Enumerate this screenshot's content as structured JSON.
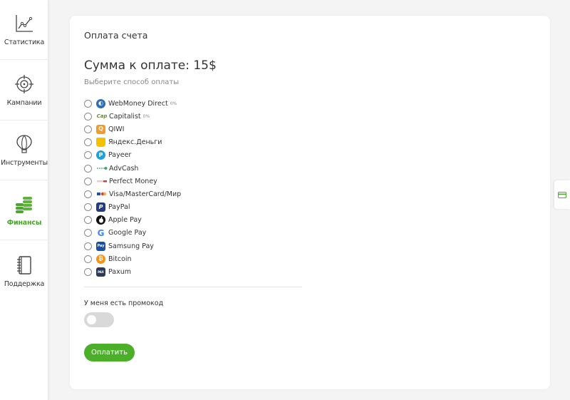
{
  "sidebar": {
    "items": [
      {
        "label": "Статистика",
        "icon": "chart-icon"
      },
      {
        "label": "Кампании",
        "icon": "target-icon"
      },
      {
        "label": "Инструменты",
        "icon": "balloon-icon"
      },
      {
        "label": "Финансы",
        "icon": "coins-icon",
        "active": true
      },
      {
        "label": "Поддержка",
        "icon": "notebook-icon"
      }
    ]
  },
  "card": {
    "title": "Оплата счета",
    "amount": "Сумма к оплате: 15$",
    "hint": "Выберите способ оплаты",
    "methods": [
      {
        "name": "WebMoney Direct",
        "fee": "0%",
        "icon": "webmoney-icon",
        "color": "#2d6fb3"
      },
      {
        "name": "Capitalist",
        "fee": "0%",
        "icon": "capitalist-icon",
        "color": "#6a8a3a"
      },
      {
        "name": "QIWI",
        "fee": "",
        "icon": "qiwi-icon",
        "color": "#f29a2e"
      },
      {
        "name": "Яндекс.Деньги",
        "fee": "",
        "icon": "yandex-money-icon",
        "color": "#f2c200"
      },
      {
        "name": "Payeer",
        "fee": "",
        "icon": "payeer-icon",
        "color": "#1ea0d8"
      },
      {
        "name": "AdvCash",
        "fee": "",
        "icon": "advcash-icon",
        "color": "#3aa776"
      },
      {
        "name": "Perfect Money",
        "fee": "",
        "icon": "perfect-money-icon",
        "color": "#d23a3a"
      },
      {
        "name": "Visa/MasterCard/Мир",
        "fee": "",
        "icon": "card-icon",
        "color": "#e87a2a"
      },
      {
        "name": "PayPal",
        "fee": "",
        "icon": "paypal-icon",
        "color": "#253b80"
      },
      {
        "name": "Apple Pay",
        "fee": "",
        "icon": "apple-icon",
        "color": "#111111"
      },
      {
        "name": "Google Pay",
        "fee": "",
        "icon": "google-icon",
        "color": "#4285f4"
      },
      {
        "name": "Samsung Pay",
        "fee": "",
        "icon": "samsung-pay-icon",
        "color": "#1b4fa0"
      },
      {
        "name": "Bitcoin",
        "fee": "",
        "icon": "bitcoin-icon",
        "color": "#f7931a"
      },
      {
        "name": "Paxum",
        "fee": "",
        "icon": "paxum-icon",
        "color": "#2a3a55"
      }
    ],
    "promo_label": "У меня есть промокод",
    "promo_enabled": false,
    "pay_button": "Оплатить"
  },
  "side_tab": {
    "icon": "credit-card-icon"
  },
  "colors": {
    "accent": "#4caf2a",
    "accent_text": "#4aa62c"
  }
}
